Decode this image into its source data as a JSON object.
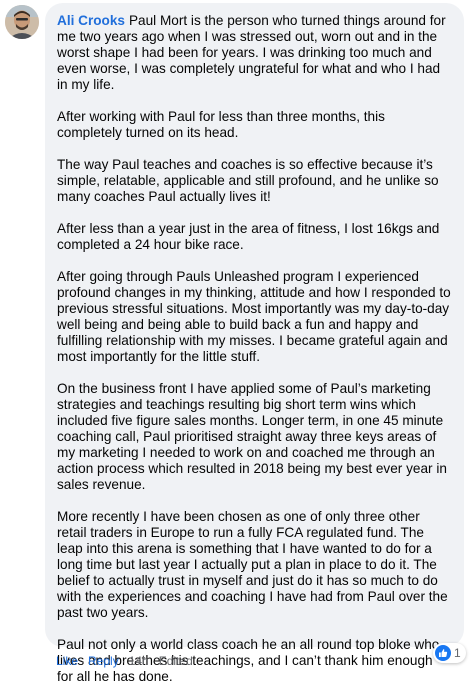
{
  "comment": {
    "author": "Ali Crooks",
    "paragraphs": [
      "Paul Mort is the person who turned things around for me two years ago when I was stressed out, worn out and in the worst shape I had been for years. I was drinking too much and even worse, I was completely ungrateful for what and who I had in my life.",
      "After working with Paul for less than three months, this completely turned on its head.",
      "The way Paul teaches and coaches is so effective because it’s simple, relatable, applicable and still profound, and he unlike so many coaches Paul actually lives it!",
      "After less than a year just in the area of fitness, I lost 16kgs and completed a 24 hour bike race.",
      "After going through Pauls Unleashed program I experienced profound changes in my thinking, attitude and how I responded to previous stressful situations. Most importantly was my day-to-day well being and being able to build back a fun and happy and fulfilling relationship with my misses. I became grateful again and most importantly for the little stuff.",
      "On the business front I have applied some of Paul’s marketing strategies and teachings resulting big short term wins which included five figure sales months. Longer term, in one 45 minute coaching call, Paul prioritised straight away three keys areas of my marketing I needed to work on and coached me through an action process which resulted in 2018 being my best ever year in sales revenue.",
      "More recently I have been chosen as one of only three other retail traders in Europe to run a fully FCA regulated fund. The leap into this arena is something that I have wanted to do for a long time but last year I actually put a plan in place to do it. The belief to actually trust in myself and just do it has so much to do with the experiences and coaching I have had from Paul over the past two years.",
      "Paul not only a world class coach he an all round top bloke who lives and breathes his teachings, and I can’t thank him enough for all he has done."
    ]
  },
  "actions": {
    "like_label": "Like",
    "separator": "·",
    "reply_label": "Reply",
    "time": "14h",
    "edited": "Edited"
  },
  "reactions": {
    "icon": "like-icon",
    "count": "1",
    "color": "#1877f2"
  },
  "colors": {
    "link": "#216fdb",
    "bubble": "#f0f2f5",
    "text": "#050505",
    "meta": "#65676b"
  }
}
